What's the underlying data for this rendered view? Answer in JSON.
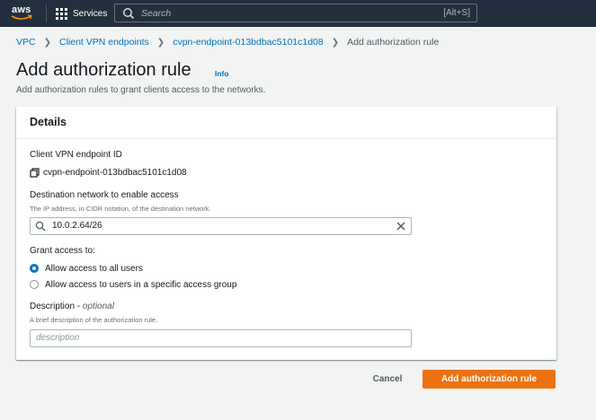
{
  "colors": {
    "topbar": "#232f3e",
    "link": "#0073bb",
    "primary_button": "#ec7211",
    "page_background": "#f2f3f3"
  },
  "topbar": {
    "logo_text": "aws",
    "services_label": "Services",
    "search_placeholder": "Search",
    "search_shortcut": "[Alt+S]",
    "icons": [
      "services-grid-icon",
      "search-icon"
    ]
  },
  "breadcrumb": [
    {
      "label": "VPC",
      "link": true
    },
    {
      "label": "Client VPN endpoints",
      "link": true
    },
    {
      "label": "cvpn-endpoint-013bdbac5101c1d08",
      "link": true
    },
    {
      "label": "Add authorization rule",
      "link": false
    }
  ],
  "page": {
    "title": "Add authorization rule",
    "info_label": "Info",
    "description": "Add authorization rules to grant clients access to the networks."
  },
  "details": {
    "heading": "Details",
    "endpoint_label": "Client VPN endpoint ID",
    "endpoint_value": "cvpn-endpoint-013bdbac5101c1d08",
    "destination_label": "Destination network to enable access",
    "destination_hint": "The IP address, in CIDR notation, of the destination network.",
    "destination_value": "10.0.2.64/26",
    "grant_label": "Grant access to:",
    "grant_options": [
      {
        "label": "Allow access to all users",
        "selected": true
      },
      {
        "label": "Allow access to users in a specific access group",
        "selected": false
      }
    ],
    "description_label": "Description",
    "description_optional": "optional",
    "description_hint": "A brief description of the authorization rule.",
    "description_placeholder": "description"
  },
  "actions": {
    "cancel_label": "Cancel",
    "submit_label": "Add authorization rule"
  }
}
